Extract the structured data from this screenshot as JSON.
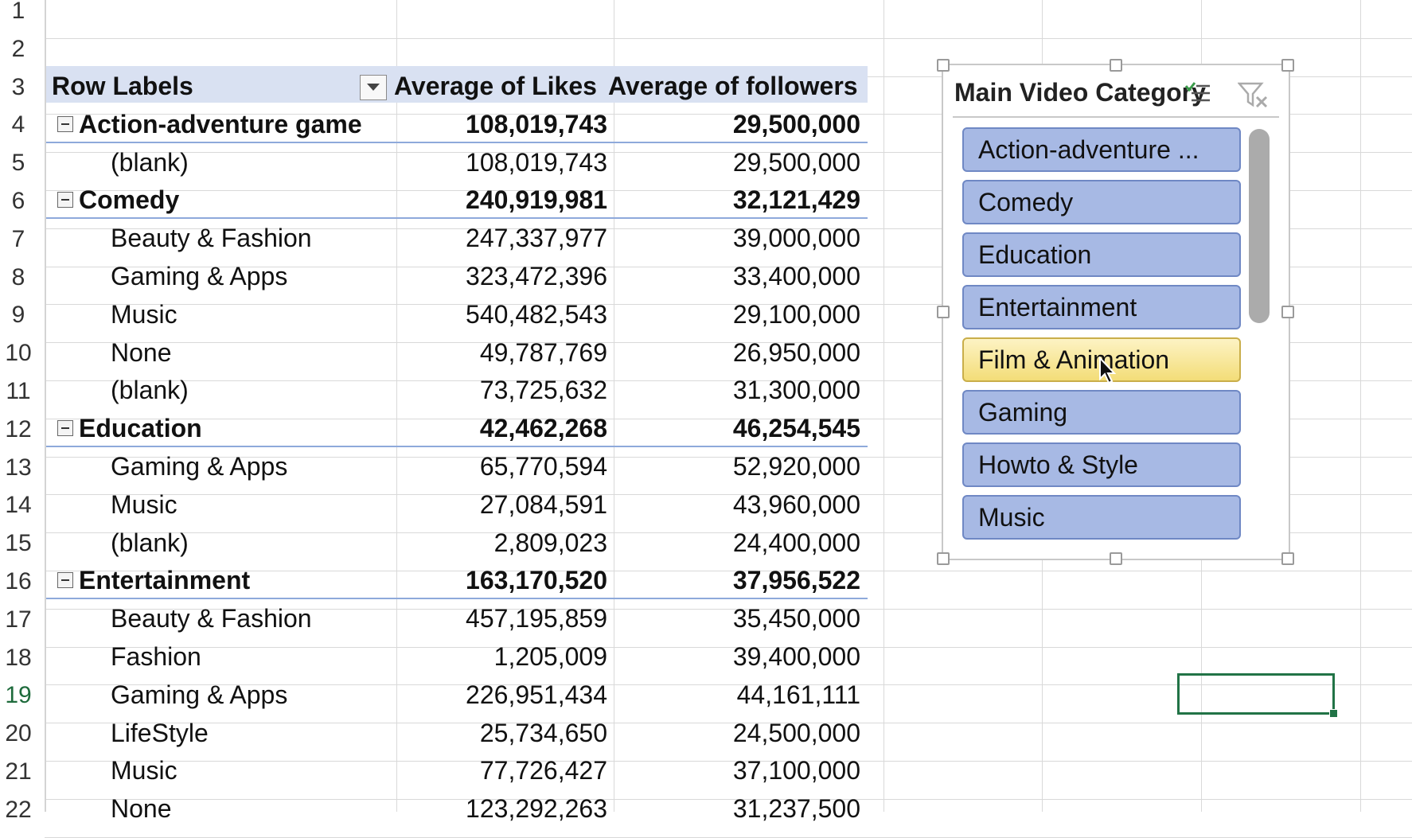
{
  "row_numbers": [
    "1",
    "2",
    "3",
    "4",
    "5",
    "6",
    "7",
    "8",
    "9",
    "10",
    "11",
    "12",
    "13",
    "14",
    "15",
    "16",
    "17",
    "18",
    "19",
    "20",
    "21",
    "22"
  ],
  "active_row": "19",
  "pivot": {
    "header": {
      "row_labels": "Row Labels",
      "col_likes": "Average of Likes",
      "col_followers": "Average of followers"
    },
    "rows": [
      {
        "label": "Action-adventure game",
        "likes": "108,019,743",
        "followers": "29,500,000",
        "group": true
      },
      {
        "label": "(blank)",
        "likes": "108,019,743",
        "followers": "29,500,000",
        "group": false
      },
      {
        "label": "Comedy",
        "likes": "240,919,981",
        "followers": "32,121,429",
        "group": true
      },
      {
        "label": "Beauty & Fashion",
        "likes": "247,337,977",
        "followers": "39,000,000",
        "group": false
      },
      {
        "label": "Gaming & Apps",
        "likes": "323,472,396",
        "followers": "33,400,000",
        "group": false
      },
      {
        "label": "Music",
        "likes": "540,482,543",
        "followers": "29,100,000",
        "group": false
      },
      {
        "label": "None",
        "likes": "49,787,769",
        "followers": "26,950,000",
        "group": false
      },
      {
        "label": "(blank)",
        "likes": "73,725,632",
        "followers": "31,300,000",
        "group": false
      },
      {
        "label": "Education",
        "likes": "42,462,268",
        "followers": "46,254,545",
        "group": true
      },
      {
        "label": "Gaming & Apps",
        "likes": "65,770,594",
        "followers": "52,920,000",
        "group": false
      },
      {
        "label": "Music",
        "likes": "27,084,591",
        "followers": "43,960,000",
        "group": false
      },
      {
        "label": "(blank)",
        "likes": "2,809,023",
        "followers": "24,400,000",
        "group": false
      },
      {
        "label": "Entertainment",
        "likes": "163,170,520",
        "followers": "37,956,522",
        "group": true
      },
      {
        "label": "Beauty & Fashion",
        "likes": "457,195,859",
        "followers": "35,450,000",
        "group": false
      },
      {
        "label": "Fashion",
        "likes": "1,205,009",
        "followers": "39,400,000",
        "group": false
      },
      {
        "label": "Gaming & Apps",
        "likes": "226,951,434",
        "followers": "44,161,111",
        "group": false
      },
      {
        "label": "LifeStyle",
        "likes": "25,734,650",
        "followers": "24,500,000",
        "group": false
      },
      {
        "label": "Music",
        "likes": "77,726,427",
        "followers": "37,100,000",
        "group": false
      },
      {
        "label": "None",
        "likes": "123,292,263",
        "followers": "31,237,500",
        "group": false
      }
    ]
  },
  "slicer": {
    "title": "Main Video Category",
    "items": [
      "Action-adventure ...",
      "Comedy",
      "Education",
      "Entertainment",
      "Film & Animation",
      "Gaming",
      "Howto & Style",
      "Music"
    ],
    "hovered_item": "Film & Animation",
    "item_color": "#a7b9e4",
    "hover_color": "#f3dd78"
  },
  "colors": {
    "pivot_header": "#d9e1f2",
    "active_cell_border": "#217346"
  }
}
